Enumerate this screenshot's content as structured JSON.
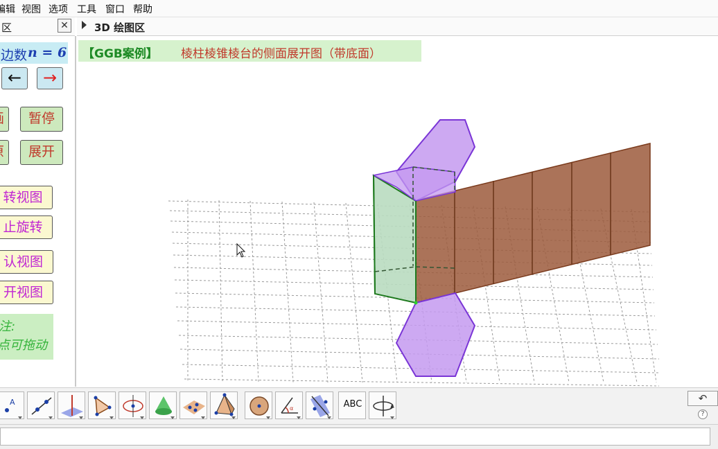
{
  "menu": [
    "编辑",
    "视图",
    "选项",
    "工具",
    "窗口",
    "帮助"
  ],
  "left_panel": {
    "header_title": "区",
    "close_label": "✕",
    "edges_label": "边数",
    "edges_formula": "n = 6",
    "arrow_left": "←",
    "arrow_right": "→",
    "buttons": {
      "start": "画",
      "pause": "暂停",
      "reset": "原",
      "unfold": "展开",
      "rotate_view": "转视图",
      "stop_rotate": "止旋转",
      "default_view": "认视图",
      "unfold_view": "开视图"
    },
    "note_title": "注:",
    "note_text": "点可拖动"
  },
  "graphics": {
    "header_title": "3D 绘图区",
    "title_prefix": "【GGB案例】",
    "title_text": "棱柱棱锥棱台的侧面展开图（带底面）"
  },
  "toolbar": {
    "tools": [
      "point-tool",
      "line-tool",
      "perpendicular-tool",
      "polygon-tool",
      "circle-tool",
      "cone-tool",
      "plane-tool",
      "pyramid-tool",
      "sphere-tool",
      "angle-tool",
      "reflect-tool",
      "text-tool",
      "rotate-view-tool"
    ],
    "text_tool_label": "ABC",
    "undo_label": "↶",
    "help_label": "?"
  },
  "colors": {
    "hexagon_fill": "#c49af0",
    "lateral_face_fill": "#9c5a3c",
    "prism_face_fill": "#b9dcc0",
    "green_button_bg": "#cde9bd",
    "yellow_button_bg": "#fbf8d0"
  }
}
